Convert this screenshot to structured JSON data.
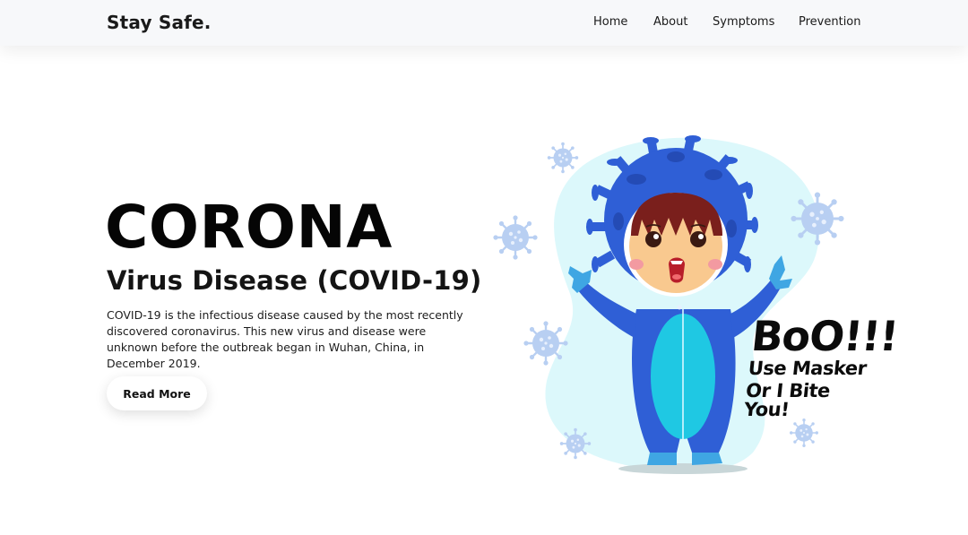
{
  "nav": {
    "logo": "Stay Safe.",
    "links": [
      "Home",
      "About",
      "Symptoms",
      "Prevention"
    ]
  },
  "hero": {
    "title": "CORONA",
    "subtitle": "Virus Disease (COVID-19)",
    "description": "COVID-19 is the infectious disease caused by the most recently discovered coronavirus. This new virus and disease were unknown before the outbreak began in Wuhan, China, in December 2019.",
    "button_label": "Read More"
  },
  "illustration": {
    "lines": [
      "BoO!!!",
      "Use Masker",
      "Or I Bite You!"
    ],
    "colors": {
      "suit_blue": "#2f5fd6",
      "belly_cyan": "#1fc8e3",
      "blob_bg": "#dcf8fb",
      "virus_light": "#a9c4ee",
      "skin": "#f9c98f",
      "hair": "#7a1f1c"
    }
  }
}
